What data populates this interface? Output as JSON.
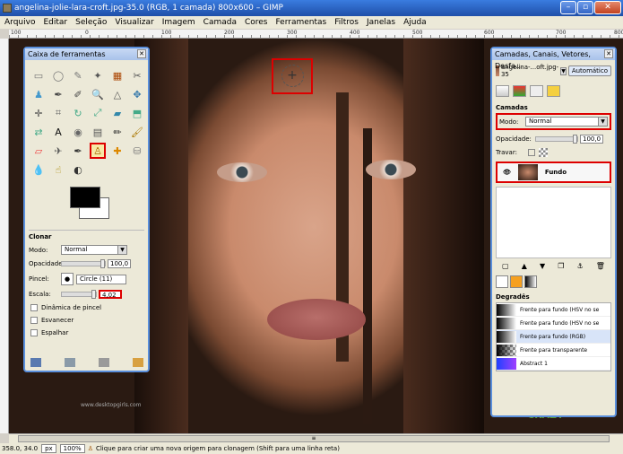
{
  "window": {
    "title": "angelina-jolie-lara-croft.jpg-35.0 (RGB, 1 camada) 800x600 – GIMP",
    "buttons": [
      "–",
      "▫",
      "✕"
    ]
  },
  "menu": [
    "Arquivo",
    "Editar",
    "Seleção",
    "Visualizar",
    "Imagem",
    "Camada",
    "Cores",
    "Ferramentas",
    "Filtros",
    "Janelas",
    "Ajuda"
  ],
  "ruler": {
    "ticks": [
      "100",
      "0",
      "100",
      "200",
      "300",
      "400",
      "500",
      "600",
      "700",
      "800"
    ]
  },
  "canvas": {
    "watermark": "www.desktopgirls.com",
    "brand_text": "CRAZY"
  },
  "toolbox": {
    "title": "Caixa de ferramentas",
    "tool_icons": [
      "rect-select-icon",
      "ellipse-select-icon",
      "free-select-icon",
      "fuzzy-select-icon",
      "color-select-icon",
      "scissors-icon",
      "foreground-select-icon",
      "paths-icon",
      "color-picker-icon",
      "zoom-icon",
      "measure-icon",
      "move-icon",
      "align-icon",
      "crop-icon",
      "rotate-icon",
      "scale-icon",
      "shear-icon",
      "perspective-icon",
      "flip-icon",
      "text-icon",
      "bucket-fill-icon",
      "blend-icon",
      "pencil-icon",
      "paintbrush-icon",
      "eraser-icon",
      "airbrush-icon",
      "ink-icon",
      "clone-icon",
      "heal-icon",
      "perspective-clone-icon",
      "blur-icon",
      "smudge-icon",
      "dodge-burn-icon"
    ],
    "options": {
      "title": "Clonar",
      "mode_label": "Modo:",
      "mode_value": "Normal",
      "opacity_label": "Opacidade:",
      "opacity_value": "100,0",
      "brush_label": "Pincel:",
      "brush_value": "Circle (11)",
      "scale_label": "Escala:",
      "scale_value": "4,02",
      "dynamics_label": "Dinâmica de pincel",
      "fade_label": "Esvanecer",
      "mirror_label": "Espalhar"
    }
  },
  "layers_panel": {
    "title": "Camadas, Canais, Vetores, Desfa...",
    "image_name": "angelina-...oft.jpg-35",
    "auto_button": "Automático",
    "section_title": "Camadas",
    "mode_label": "Modo:",
    "mode_value": "Normal",
    "opacity_label": "Opacidade:",
    "opacity_value": "100,0",
    "lock_label": "Travar:",
    "layer_name": "Fundo",
    "gradients_title": "Degradês",
    "gradients": [
      "Frente para fundo (HSV no se",
      "Frente para fundo (HSV no se",
      "Frente para fundo (RGB)",
      "Frente para transparente",
      "Abstract 1"
    ]
  },
  "status": {
    "coords": "358.0, 34.0",
    "unit": "px",
    "zoom": "100%",
    "message": "Clique para criar uma nova origem para clonagem (Shift para uma linha reta)"
  }
}
